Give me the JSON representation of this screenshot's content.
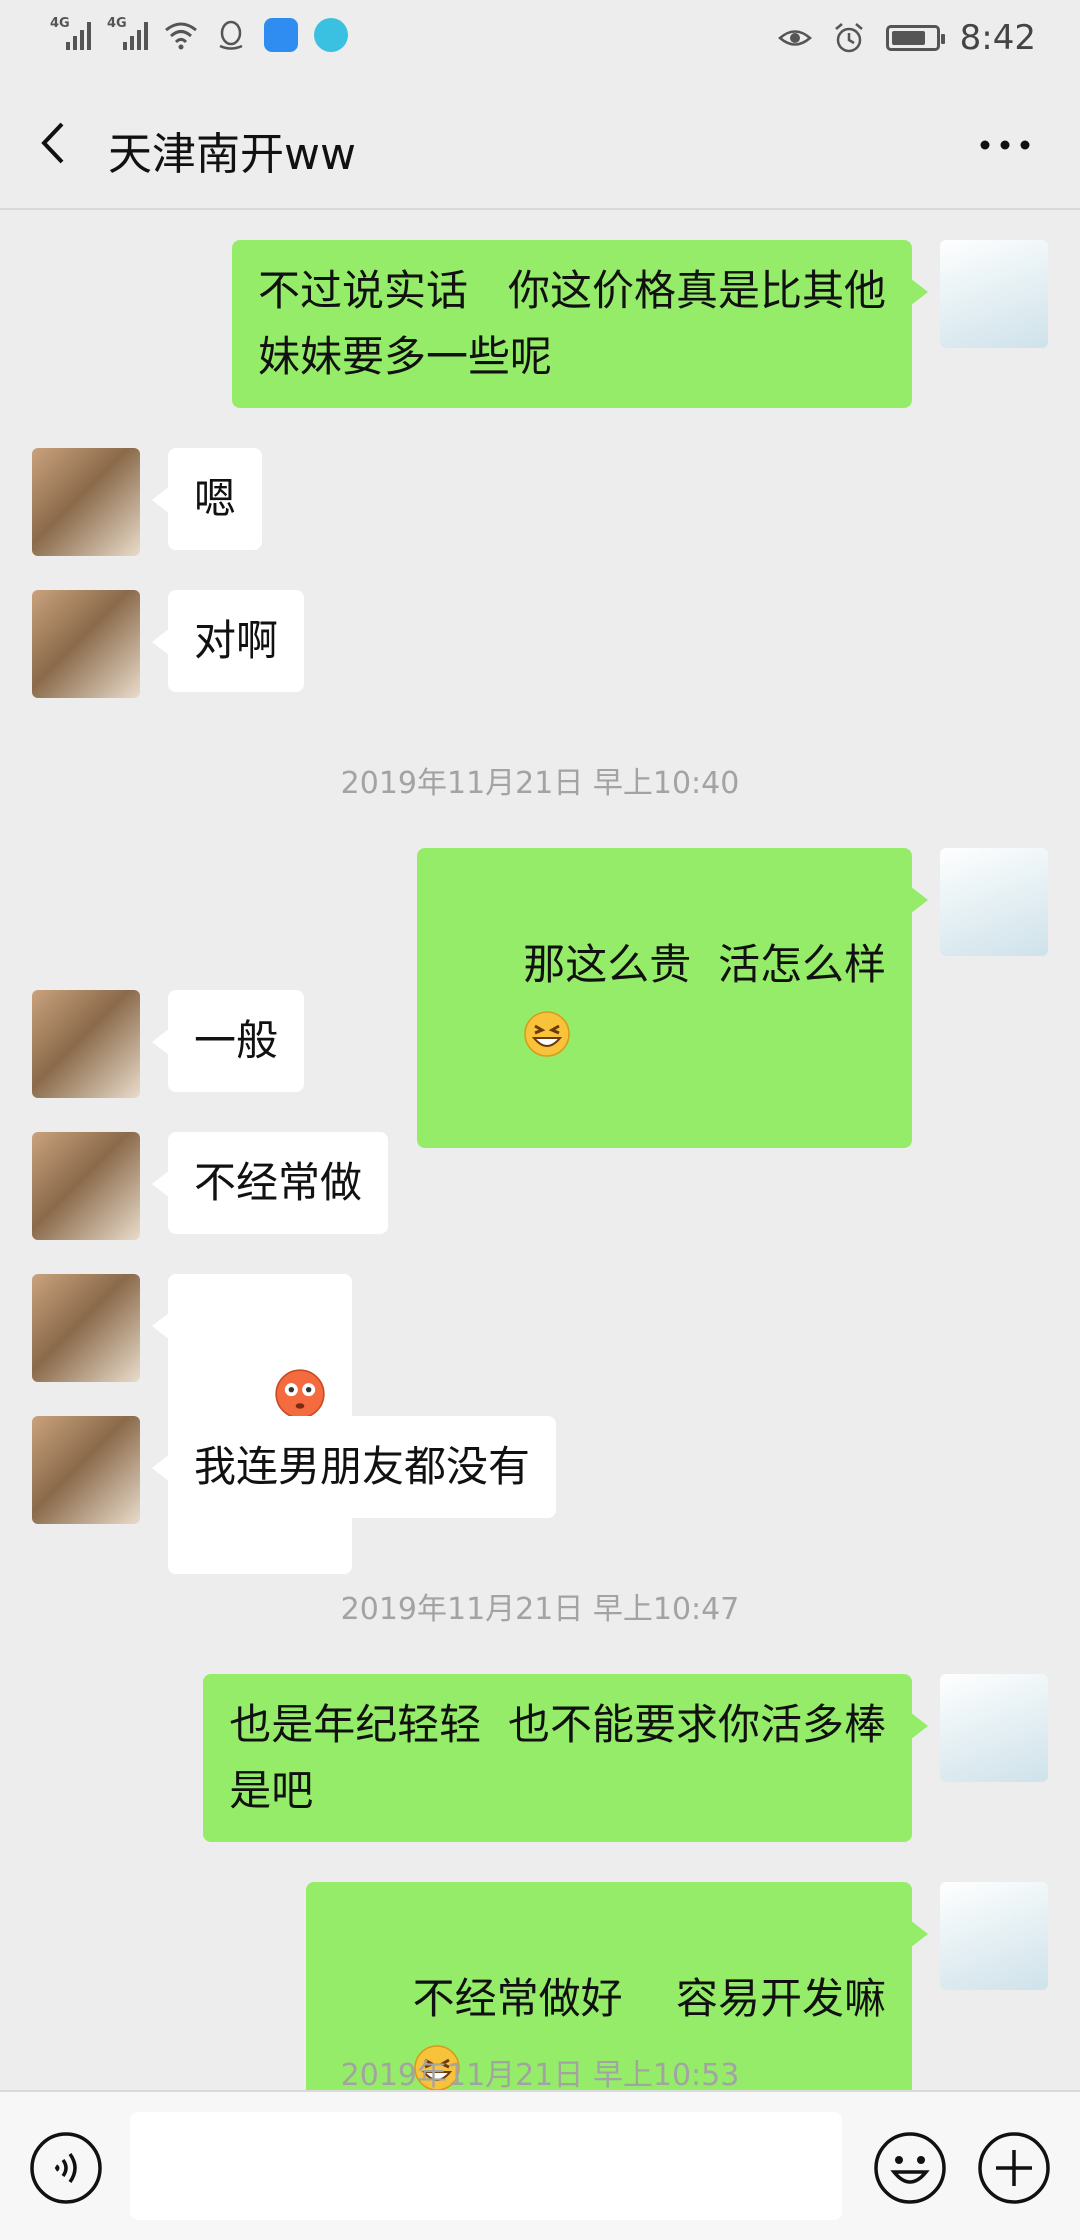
{
  "status_bar": {
    "signal1_tag": "4G",
    "signal2_tag": "4G",
    "time": "8:42",
    "battery_level_percent": 80
  },
  "header": {
    "title": "天津南开ww"
  },
  "messages": [
    {
      "from": "self",
      "text": "不过说实话   你这价格真是比其他\n妹妹要多一些呢"
    },
    {
      "from": "other",
      "text": "嗯"
    },
    {
      "from": "other",
      "text": "对啊"
    },
    {
      "timestamp": "2019年11月21日 早上10:40"
    },
    {
      "from": "self",
      "text": "那这么贵  活怎么样",
      "emoji": "grin-squint"
    },
    {
      "from": "other",
      "text": "一般"
    },
    {
      "from": "other",
      "text": "不经常做"
    },
    {
      "from": "other",
      "text": "",
      "emoji": "flushed-face x2"
    },
    {
      "from": "other",
      "text": "我连男朋友都没有"
    },
    {
      "timestamp": "2019年11月21日 早上10:47"
    },
    {
      "from": "self",
      "text": "也是年纪轻轻  也不能要求你活多棒\n是吧"
    },
    {
      "from": "self",
      "text": "不经常做好    容易开发嘛",
      "emoji": "grin-squint"
    },
    {
      "timestamp": "2019年11月21日 早上10:53"
    }
  ],
  "input_bar": {
    "placeholder": "",
    "voice_icon": "voice-icon",
    "emoji_icon": "smiley-icon",
    "plus_icon": "plus-icon"
  },
  "colors": {
    "background": "#ededed",
    "self_bubble": "#95ec69",
    "other_bubble": "#ffffff",
    "timestamp": "#a3a3a3"
  }
}
